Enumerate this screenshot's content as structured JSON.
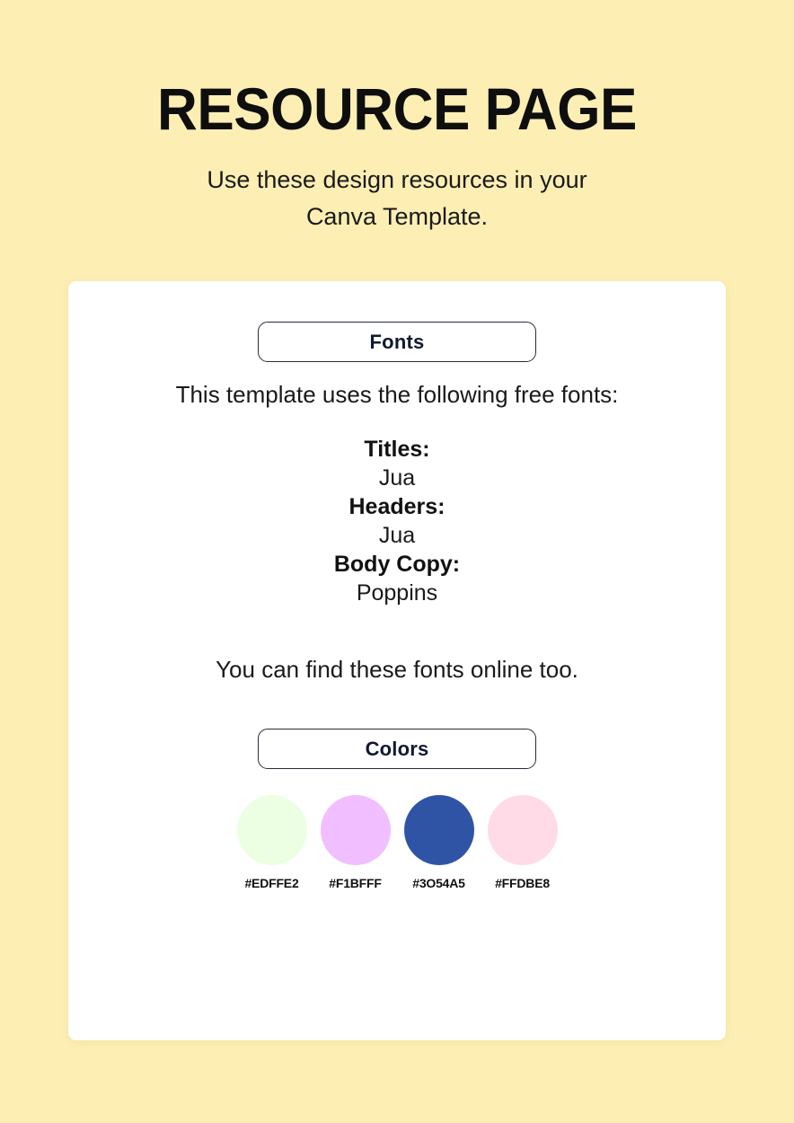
{
  "header": {
    "title": "RESOURCE PAGE",
    "subtitle": "Use these design resources in your Canva Template."
  },
  "card": {
    "fonts_section": {
      "pill_label": "Fonts",
      "intro": "This template uses the following free fonts:",
      "entries": [
        {
          "label": "Titles:",
          "value": "Jua"
        },
        {
          "label": "Headers:",
          "value": "Jua"
        },
        {
          "label": "Body Copy:",
          "value": "Poppins"
        }
      ],
      "footnote": "You can find these fonts online too."
    },
    "colors_section": {
      "pill_label": "Colors",
      "swatches": [
        {
          "hex_label": "#EDFFE2",
          "color": "#EDFFE2"
        },
        {
          "hex_label": "#F1BFFF",
          "color": "#F1BFFF"
        },
        {
          "hex_label": "#3O54A5",
          "color": "#3054A5"
        },
        {
          "hex_label": "#FFDBE8",
          "color": "#FFDBE8"
        }
      ]
    }
  },
  "theme": {
    "background": "#FDEFB4",
    "card_background": "#FFFFFF",
    "text": "#111111",
    "pill_border": "#262B3A"
  }
}
